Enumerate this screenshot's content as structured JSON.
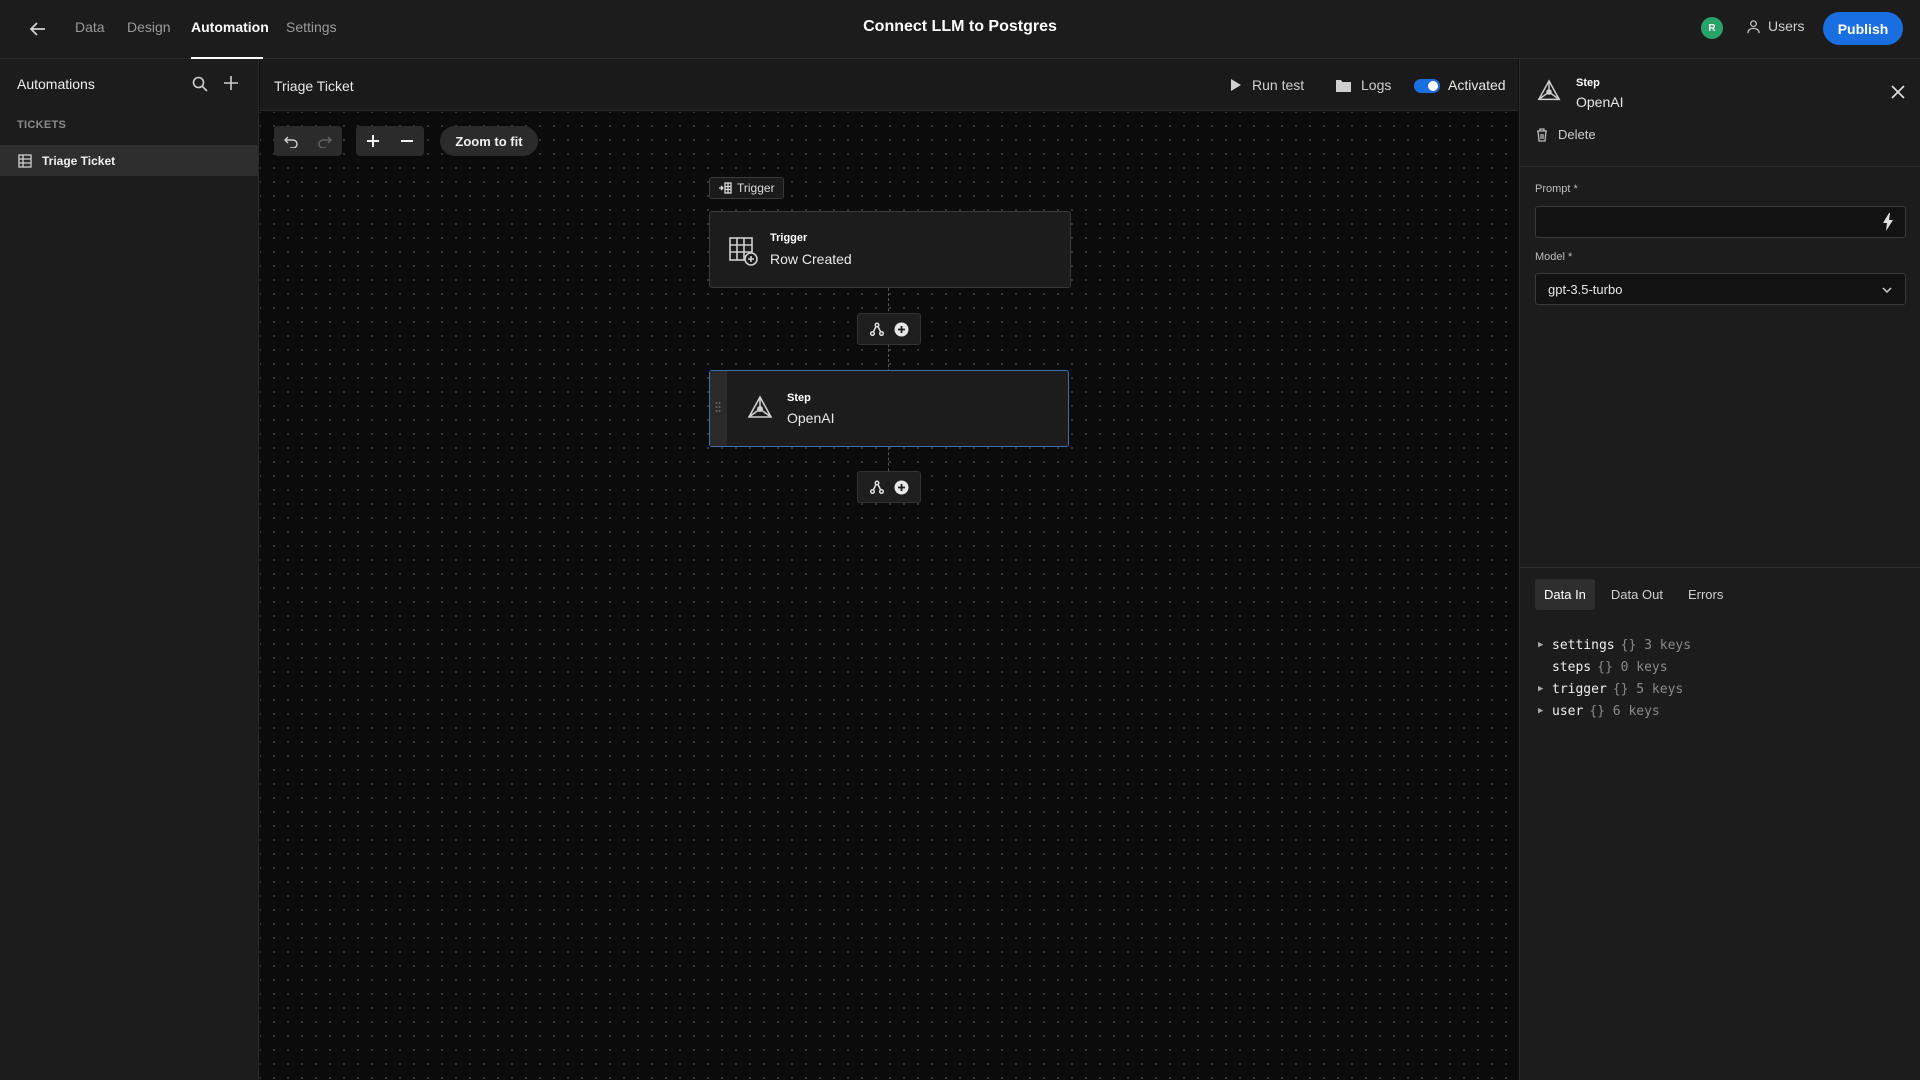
{
  "header": {
    "tabs": [
      {
        "label": "Data"
      },
      {
        "label": "Design"
      },
      {
        "label": "Automation"
      },
      {
        "label": "Settings"
      }
    ],
    "title": "Connect LLM to Postgres",
    "avatar_initial": "R",
    "users_label": "Users",
    "publish_label": "Publish",
    "accent": "#1a6fe0"
  },
  "sidebar": {
    "title": "Automations",
    "section": "TICKETS",
    "items": [
      {
        "label": "Triage Ticket"
      }
    ]
  },
  "canvas": {
    "title": "Triage Ticket",
    "run_test_label": "Run test",
    "logs_label": "Logs",
    "activated_label": "Activated",
    "zoom_fit_label": "Zoom to fit",
    "trigger_chip_label": "Trigger",
    "trigger_node": {
      "label": "Trigger",
      "value": "Row Created"
    },
    "step_node": {
      "label": "Step",
      "value": "OpenAI"
    }
  },
  "panel": {
    "label": "Step",
    "value": "OpenAI",
    "delete_label": "Delete",
    "prompt_label": "Prompt *",
    "prompt_value": "",
    "model_label": "Model *",
    "model_value": "gpt-3.5-turbo",
    "data_tabs": [
      {
        "label": "Data In"
      },
      {
        "label": "Data Out"
      },
      {
        "label": "Errors"
      }
    ],
    "tree": [
      {
        "key": "settings",
        "meta": "{} 3 keys"
      },
      {
        "key": "steps",
        "meta": "{} 0 keys"
      },
      {
        "key": "trigger",
        "meta": "{} 5 keys"
      },
      {
        "key": "user",
        "meta": "{} 6 keys"
      }
    ]
  }
}
